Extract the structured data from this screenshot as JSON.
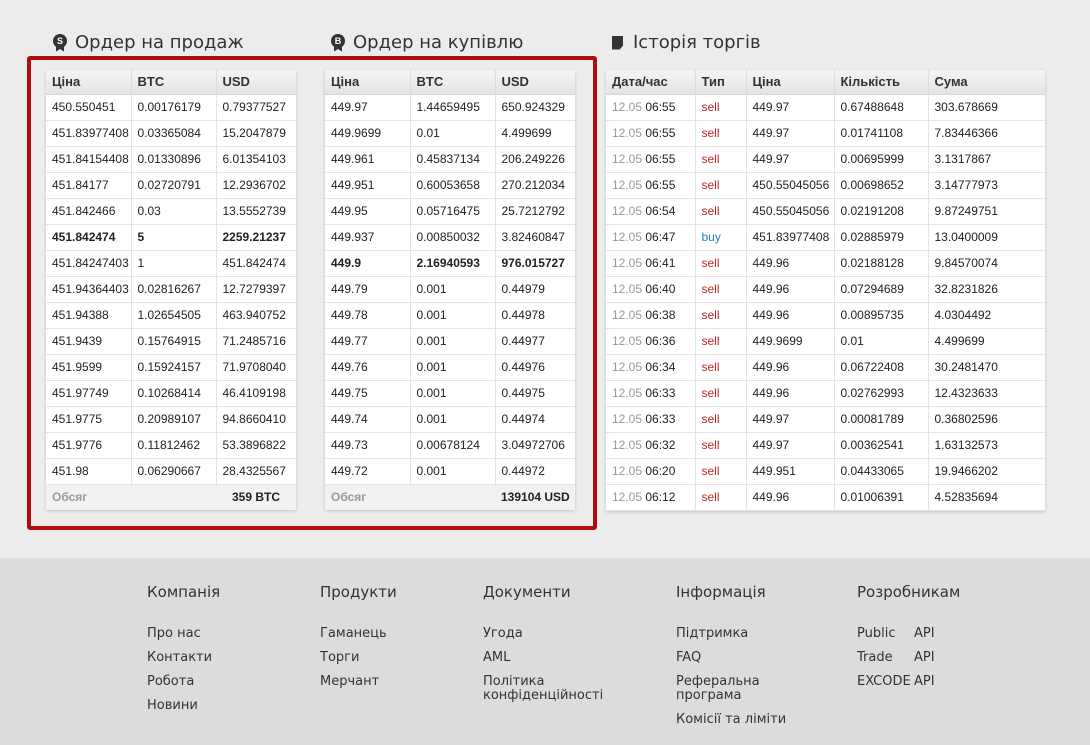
{
  "sell_orders": {
    "title": "Ордер на продаж",
    "icon_letter": "S",
    "columns": [
      "Ціна",
      "BTC",
      "USD"
    ],
    "rows": [
      [
        "450.550451",
        "0.00176179",
        "0.79377527"
      ],
      [
        "451.83977408",
        "0.03365084",
        "15.2047879"
      ],
      [
        "451.84154408",
        "0.01330896",
        "6.01354103"
      ],
      [
        "451.84177",
        "0.02720791",
        "12.2936702"
      ],
      [
        "451.842466",
        "0.03",
        "13.5552739"
      ],
      [
        "451.842474",
        "5",
        "2259.21237"
      ],
      [
        "451.84247403",
        "1",
        "451.842474"
      ],
      [
        "451.94364403",
        "0.02816267",
        "12.7279397"
      ],
      [
        "451.94388",
        "1.02654505",
        "463.940752"
      ],
      [
        "451.9439",
        "0.15764915",
        "71.2485716"
      ],
      [
        "451.9599",
        "0.15924157",
        "71.9708040"
      ],
      [
        "451.97749",
        "0.10268414",
        "46.4109198"
      ],
      [
        "451.9775",
        "0.20989107",
        "94.8660410"
      ],
      [
        "451.9776",
        "0.11812462",
        "53.3896822"
      ],
      [
        "451.98",
        "0.06290667",
        "28.4325567"
      ]
    ],
    "bold_row": 5,
    "total_label": "Обсяг",
    "total_value": "359 BTC"
  },
  "buy_orders": {
    "title": "Ордер на купівлю",
    "icon_letter": "B",
    "columns": [
      "Ціна",
      "BTC",
      "USD"
    ],
    "rows": [
      [
        "449.97",
        "1.44659495",
        "650.924329"
      ],
      [
        "449.9699",
        "0.01",
        "4.499699"
      ],
      [
        "449.961",
        "0.45837134",
        "206.249226"
      ],
      [
        "449.951",
        "0.60053658",
        "270.212034"
      ],
      [
        "449.95",
        "0.05716475",
        "25.7212792"
      ],
      [
        "449.937",
        "0.00850032",
        "3.82460847"
      ],
      [
        "449.9",
        "2.16940593",
        "976.015727"
      ],
      [
        "449.79",
        "0.001",
        "0.44979"
      ],
      [
        "449.78",
        "0.001",
        "0.44978"
      ],
      [
        "449.77",
        "0.001",
        "0.44977"
      ],
      [
        "449.76",
        "0.001",
        "0.44976"
      ],
      [
        "449.75",
        "0.001",
        "0.44975"
      ],
      [
        "449.74",
        "0.001",
        "0.44974"
      ],
      [
        "449.73",
        "0.00678124",
        "3.04972706"
      ],
      [
        "449.72",
        "0.001",
        "0.44972"
      ]
    ],
    "bold_row": 6,
    "total_label": "Обсяг",
    "total_value": "139104 USD"
  },
  "trade_history": {
    "title": "Історія торгів",
    "columns": [
      "Дата/час",
      "Тип",
      "Ціна",
      "Кількість",
      "Сума"
    ],
    "rows": [
      [
        "12.05",
        "06:55",
        "sell",
        "449.97",
        "0.67488648",
        "303.678669"
      ],
      [
        "12.05",
        "06:55",
        "sell",
        "449.97",
        "0.01741108",
        "7.83446366"
      ],
      [
        "12.05",
        "06:55",
        "sell",
        "449.97",
        "0.00695999",
        "3.1317867"
      ],
      [
        "12.05",
        "06:55",
        "sell",
        "450.55045056",
        "0.00698652",
        "3.14777973"
      ],
      [
        "12.05",
        "06:54",
        "sell",
        "450.55045056",
        "0.02191208",
        "9.87249751"
      ],
      [
        "12.05",
        "06:47",
        "buy",
        "451.83977408",
        "0.02885979",
        "13.0400009"
      ],
      [
        "12.05",
        "06:41",
        "sell",
        "449.96",
        "0.02188128",
        "9.84570074"
      ],
      [
        "12.05",
        "06:40",
        "sell",
        "449.96",
        "0.07294689",
        "32.8231826"
      ],
      [
        "12.05",
        "06:38",
        "sell",
        "449.96",
        "0.00895735",
        "4.0304492"
      ],
      [
        "12.05",
        "06:36",
        "sell",
        "449.9699",
        "0.01",
        "4.499699"
      ],
      [
        "12.05",
        "06:34",
        "sell",
        "449.96",
        "0.06722408",
        "30.2481470"
      ],
      [
        "12.05",
        "06:33",
        "sell",
        "449.96",
        "0.02762993",
        "12.4323633"
      ],
      [
        "12.05",
        "06:33",
        "sell",
        "449.97",
        "0.00081789",
        "0.36802596"
      ],
      [
        "12.05",
        "06:32",
        "sell",
        "449.97",
        "0.00362541",
        "1.63132573"
      ],
      [
        "12.05",
        "06:20",
        "sell",
        "449.951",
        "0.04433065",
        "19.9466202"
      ],
      [
        "12.05",
        "06:12",
        "sell",
        "449.96",
        "0.01006391",
        "4.52835694"
      ]
    ]
  },
  "footer": {
    "company": {
      "title": "Компанія",
      "links": [
        "Про нас",
        "Контакти",
        "Робота",
        "Новини"
      ]
    },
    "products": {
      "title": "Продукти",
      "links": [
        "Гаманець",
        "Торги",
        "Мерчант"
      ]
    },
    "documents": {
      "title": "Документи",
      "links": [
        "Угода",
        "AML",
        "Політика конфіденційності"
      ]
    },
    "info": {
      "title": "Інформація",
      "links": [
        "Підтримка",
        "FAQ",
        "Реферальна програма",
        "Комісії та ліміти"
      ]
    },
    "developers": {
      "title": "Розробникам",
      "links": [
        {
          "name": "Public",
          "api": "API"
        },
        {
          "name": "Trade",
          "api": "API"
        },
        {
          "name": "EXCODE",
          "api": "API"
        }
      ]
    }
  },
  "colors": {
    "sell": "#c22525",
    "buy": "#2f7ec9",
    "highlight_frame": "#b00d0d"
  }
}
